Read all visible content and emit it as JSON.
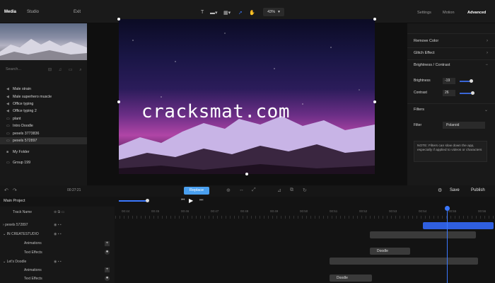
{
  "top_tabs": {
    "media": "Media",
    "studio": "Studio",
    "exit": "Exit"
  },
  "zoom": "43%",
  "right_tabs": {
    "settings": "Settings",
    "motion": "Motion",
    "advanced": "Advanced"
  },
  "search_placeholder": "Search...",
  "media_items": [
    {
      "label": "Male strain",
      "icon": "audio-icon"
    },
    {
      "label": "Male superhero muscle",
      "icon": "audio-icon"
    },
    {
      "label": "Office typing",
      "icon": "audio-icon"
    },
    {
      "label": "Office typing 2",
      "icon": "audio-icon"
    },
    {
      "label": "plant",
      "icon": "video-icon"
    },
    {
      "label": "Intro Doodle",
      "icon": "video-icon"
    },
    {
      "label": "pexels 3773836",
      "icon": "video-icon"
    },
    {
      "label": "pexels 572897",
      "icon": "video-icon"
    },
    {
      "label": "My Folder",
      "icon": "folder-icon"
    },
    {
      "label": "Group 199",
      "icon": "video-icon"
    }
  ],
  "watermark": "cracksmat.com",
  "right_panel": {
    "remove_color": "Remove Color",
    "glitch_effect": "Glitch Effect",
    "brightness_contrast": "Brightness / Contrast",
    "brightness_label": "Brightness",
    "brightness_value": "-19",
    "contrast_label": "Contrast",
    "contrast_value": "26",
    "filters": "Filters",
    "filter_label": "Filter",
    "filter_value": "Polaroid",
    "note": "NOTE: Filters can slow down the app, especially if applied to videos or characters"
  },
  "time_left": "00:27:21",
  "replace_label": "Replace",
  "save_label": "Save",
  "publish_label": "Publish",
  "timeline": {
    "project_tab": "Main Project",
    "track_header": "Track Name",
    "tracks": [
      {
        "label": "pexels 572897"
      },
      {
        "label": "IN CREATESTUDIO"
      },
      {
        "label": "Animations"
      },
      {
        "label": "Text Effects"
      },
      {
        "label": "Let's Doodle"
      },
      {
        "label": "Animations"
      },
      {
        "label": "Text Effects"
      }
    ],
    "ruler_ticks": [
      "00:44",
      "00:45",
      "00:46",
      "00:47",
      "00:48",
      "00:49",
      "00:50",
      "00:51",
      "00:52",
      "00:53",
      "00:54",
      "00:55",
      "00:56"
    ],
    "clip_labels": [
      "Doodle",
      "Doodle"
    ]
  }
}
